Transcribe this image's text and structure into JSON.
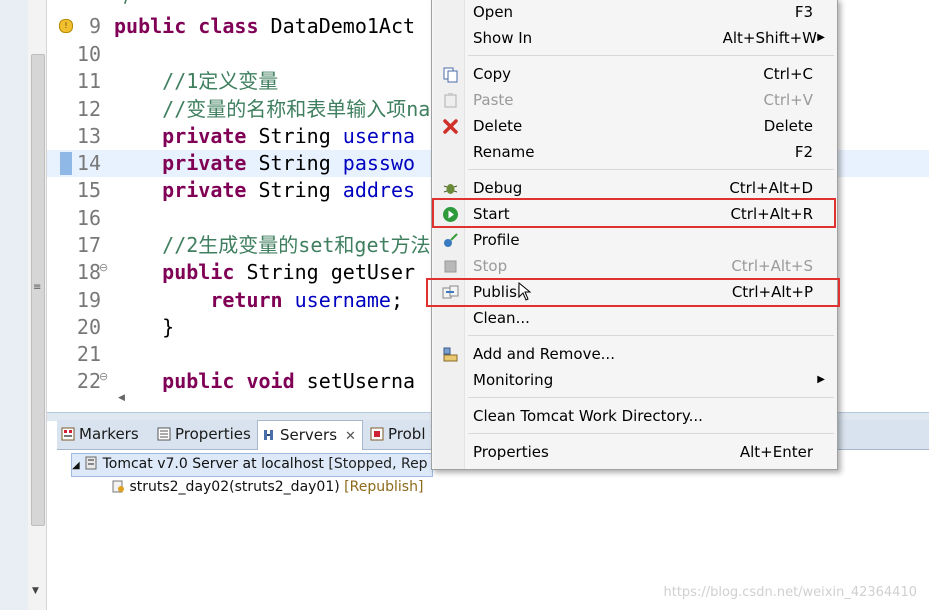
{
  "editor": {
    "lines": [
      {
        "num": "9",
        "segments": [
          {
            "t": "public class ",
            "c": "kw"
          },
          {
            "t": "DataDemo1Act",
            "c": ""
          }
        ]
      },
      {
        "num": "10",
        "segments": []
      },
      {
        "num": "11",
        "segments": [
          {
            "t": "    //1定义变量",
            "c": "cm"
          }
        ]
      },
      {
        "num": "12",
        "segments": [
          {
            "t": "    //变量的名称和表单输入项name",
            "c": "cm"
          }
        ]
      },
      {
        "num": "13",
        "segments": [
          {
            "t": "    private ",
            "c": "kw"
          },
          {
            "t": "String ",
            "c": ""
          },
          {
            "t": "userna",
            "c": "fld"
          }
        ]
      },
      {
        "num": "14",
        "segments": [
          {
            "t": "    private ",
            "c": "kw"
          },
          {
            "t": "String ",
            "c": ""
          },
          {
            "t": "passwo",
            "c": "fld"
          }
        ]
      },
      {
        "num": "15",
        "segments": [
          {
            "t": "    private ",
            "c": "kw"
          },
          {
            "t": "String ",
            "c": ""
          },
          {
            "t": "addres",
            "c": "fld"
          }
        ]
      },
      {
        "num": "16",
        "segments": []
      },
      {
        "num": "17",
        "segments": [
          {
            "t": "    //2生成变量的set和get方法",
            "c": "cm"
          }
        ]
      },
      {
        "num": "18",
        "segments": [
          {
            "t": "    public ",
            "c": "kw"
          },
          {
            "t": "String getUser",
            "c": ""
          }
        ]
      },
      {
        "num": "19",
        "segments": [
          {
            "t": "        return ",
            "c": "kw"
          },
          {
            "t": "username",
            "c": "fld"
          },
          {
            "t": ";",
            "c": ""
          }
        ]
      },
      {
        "num": "20",
        "segments": [
          {
            "t": "    }",
            "c": ""
          }
        ]
      },
      {
        "num": "21",
        "segments": []
      },
      {
        "num": "22",
        "segments": [
          {
            "t": "    public void ",
            "c": "kw"
          },
          {
            "t": "setUserna",
            "c": ""
          }
        ]
      }
    ]
  },
  "tabs": {
    "markers": "Markers",
    "properties": "Properties",
    "servers": "Servers",
    "problems": "Probl"
  },
  "servers": {
    "server_name": "Tomcat v7.0 Server at localhost",
    "server_status": "[Stopped, Rep",
    "module_name": "struts2_day02(struts2_day01)",
    "module_status": "[Republish]"
  },
  "menu": {
    "items": [
      {
        "label": "Open",
        "shortcut": "F3"
      },
      {
        "label": "Show In",
        "shortcut": "Alt+Shift+W"
      },
      {
        "label": "Copy",
        "shortcut": "Ctrl+C"
      },
      {
        "label": "Paste",
        "shortcut": "Ctrl+V"
      },
      {
        "label": "Delete",
        "shortcut": "Delete"
      },
      {
        "label": "Rename",
        "shortcut": "F2"
      },
      {
        "label": "Debug",
        "shortcut": "Ctrl+Alt+D"
      },
      {
        "label": "Start",
        "shortcut": "Ctrl+Alt+R"
      },
      {
        "label": "Profile",
        "shortcut": ""
      },
      {
        "label": "Stop",
        "shortcut": "Ctrl+Alt+S"
      },
      {
        "label": "Publish",
        "shortcut": "Ctrl+Alt+P"
      },
      {
        "label": "Clean...",
        "shortcut": ""
      },
      {
        "label": "Add and Remove...",
        "shortcut": ""
      },
      {
        "label": "Monitoring",
        "shortcut": ""
      },
      {
        "label": "Clean Tomcat Work Directory...",
        "shortcut": ""
      },
      {
        "label": "Properties",
        "shortcut": "Alt+Enter"
      }
    ]
  },
  "watermark": "https://blog.csdn.net/weixin_42364410",
  "colors": {
    "highlight_box": "#e03030",
    "keyword": "#7f0055",
    "comment": "#3f7f5f",
    "field": "#0000c0"
  }
}
